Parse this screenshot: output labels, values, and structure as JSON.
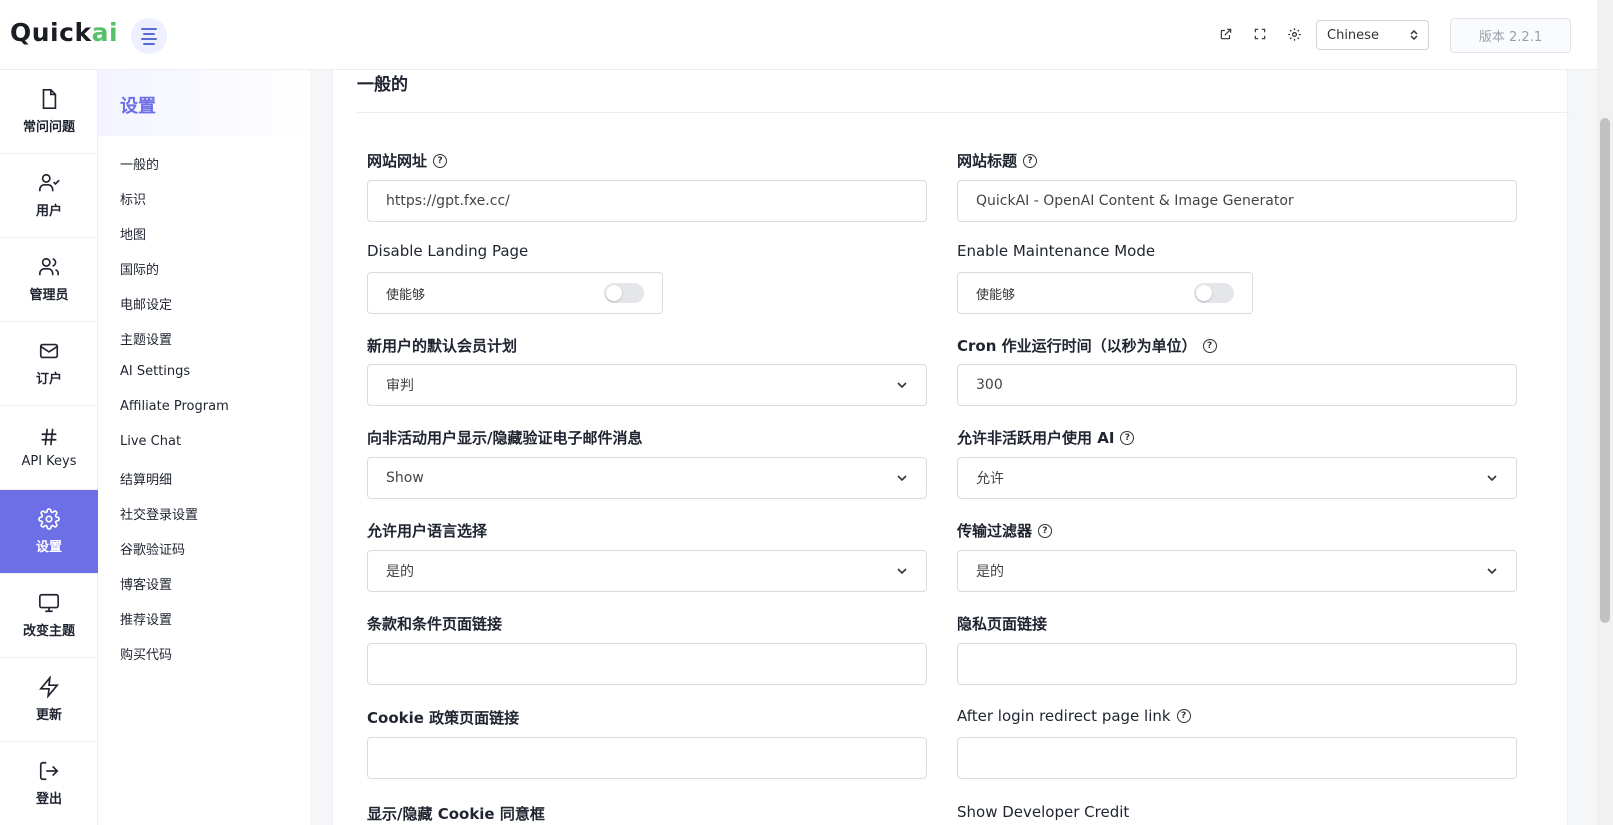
{
  "header": {
    "logo_main": "Quick",
    "logo_ai": "ai",
    "language_selected": "Chinese",
    "version_label": "版本 2.2.1"
  },
  "icon_nav": [
    {
      "label": "常问问题",
      "icon": "document-icon"
    },
    {
      "label": "用户",
      "icon": "user-check-icon"
    },
    {
      "label": "管理员",
      "icon": "users-icon"
    },
    {
      "label": "订户",
      "icon": "mail-icon"
    },
    {
      "label": "API Keys",
      "icon": "hash-icon"
    },
    {
      "label": "设置",
      "icon": "gear-icon",
      "active": true
    },
    {
      "label": "改变主题",
      "icon": "monitor-icon"
    },
    {
      "label": "更新",
      "icon": "lightning-icon"
    },
    {
      "label": "登出",
      "icon": "logout-icon"
    }
  ],
  "sub_nav": {
    "title": "设置",
    "items": [
      "一般的",
      "标识",
      "地图",
      "国际的",
      "电邮设定",
      "主题设置",
      "AI Settings",
      "Affiliate Program",
      "Live Chat",
      "结算明细",
      "社交登录设置",
      "谷歌验证码",
      "博客设置",
      "推荐设置",
      "购买代码"
    ]
  },
  "section": {
    "title": "一般的"
  },
  "form": {
    "site_url_label": "网站网址",
    "site_url_value": "https://gpt.fxe.cc/",
    "site_title_label": "网站标题",
    "site_title_value": "QuickAI - OpenAI Content & Image Generator",
    "disable_landing_label": "Disable Landing Page",
    "disable_landing_toggle": "使能够",
    "maintenance_label": "Enable Maintenance Mode",
    "maintenance_toggle": "使能够",
    "default_plan_label": "新用户的默认会员计划",
    "default_plan_value": "审判",
    "cron_label": "Cron 作业运行时间（以秒为单位）",
    "cron_value": "300",
    "verify_email_label": "向非活动用户显示/隐藏验证电子邮件消息",
    "verify_email_value": "Show",
    "inactive_ai_label": "允许非活跃用户使用 AI",
    "inactive_ai_value": "允许",
    "lang_select_label": "允许用户语言选择",
    "lang_select_value": "是的",
    "transfer_filter_label": "传输过滤器",
    "transfer_filter_value": "是的",
    "terms_link_label": "条款和条件页面链接",
    "terms_link_value": "",
    "privacy_link_label": "隐私页面链接",
    "privacy_link_value": "",
    "cookie_link_label": "Cookie 政策页面链接",
    "cookie_link_value": "",
    "after_login_label": "After login redirect page link",
    "after_login_value": "",
    "cookie_consent_label": "显示/隐藏 Cookie 同意框",
    "developer_credit_label": "Show Developer Credit"
  }
}
